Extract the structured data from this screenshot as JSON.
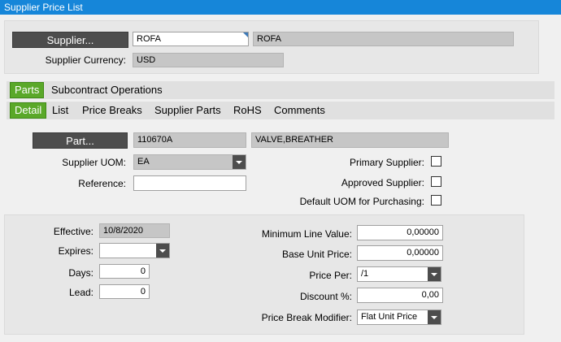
{
  "window": {
    "title": "Supplier Price List"
  },
  "supplier": {
    "button_label": "Supplier...",
    "code": "ROFA",
    "name": "ROFA",
    "currency_label": "Supplier Currency:",
    "currency": "USD"
  },
  "tabs_primary": [
    {
      "label": "Parts",
      "active": true
    },
    {
      "label": "Subcontract Operations",
      "active": false
    }
  ],
  "tabs_secondary": [
    {
      "label": "Detail",
      "active": true
    },
    {
      "label": "List",
      "active": false
    },
    {
      "label": "Price Breaks",
      "active": false
    },
    {
      "label": "Supplier Parts",
      "active": false
    },
    {
      "label": "RoHS",
      "active": false
    },
    {
      "label": "Comments",
      "active": false
    }
  ],
  "part": {
    "button_label": "Part...",
    "number": "110670A",
    "description": "VALVE,BREATHER",
    "uom_label": "Supplier UOM:",
    "uom": "EA",
    "reference_label": "Reference:",
    "reference": "",
    "primary_supplier_label": "Primary Supplier:",
    "approved_supplier_label": "Approved Supplier:",
    "default_uom_label": "Default UOM for Purchasing:"
  },
  "pricing": {
    "effective_label": "Effective:",
    "effective": "10/8/2020",
    "expires_label": "Expires:",
    "expires": "",
    "days_label": "Days:",
    "days": "0",
    "lead_label": "Lead:",
    "lead": "0",
    "min_line_value_label": "Minimum Line Value:",
    "min_line_value": "0,00000",
    "base_unit_price_label": "Base Unit Price:",
    "base_unit_price": "0,00000",
    "price_per_label": "Price Per:",
    "price_per": "/1",
    "discount_label": "Discount %:",
    "discount": "0,00",
    "price_break_modifier_label": "Price Break Modifier:",
    "price_break_modifier": "Flat Unit Price"
  }
}
